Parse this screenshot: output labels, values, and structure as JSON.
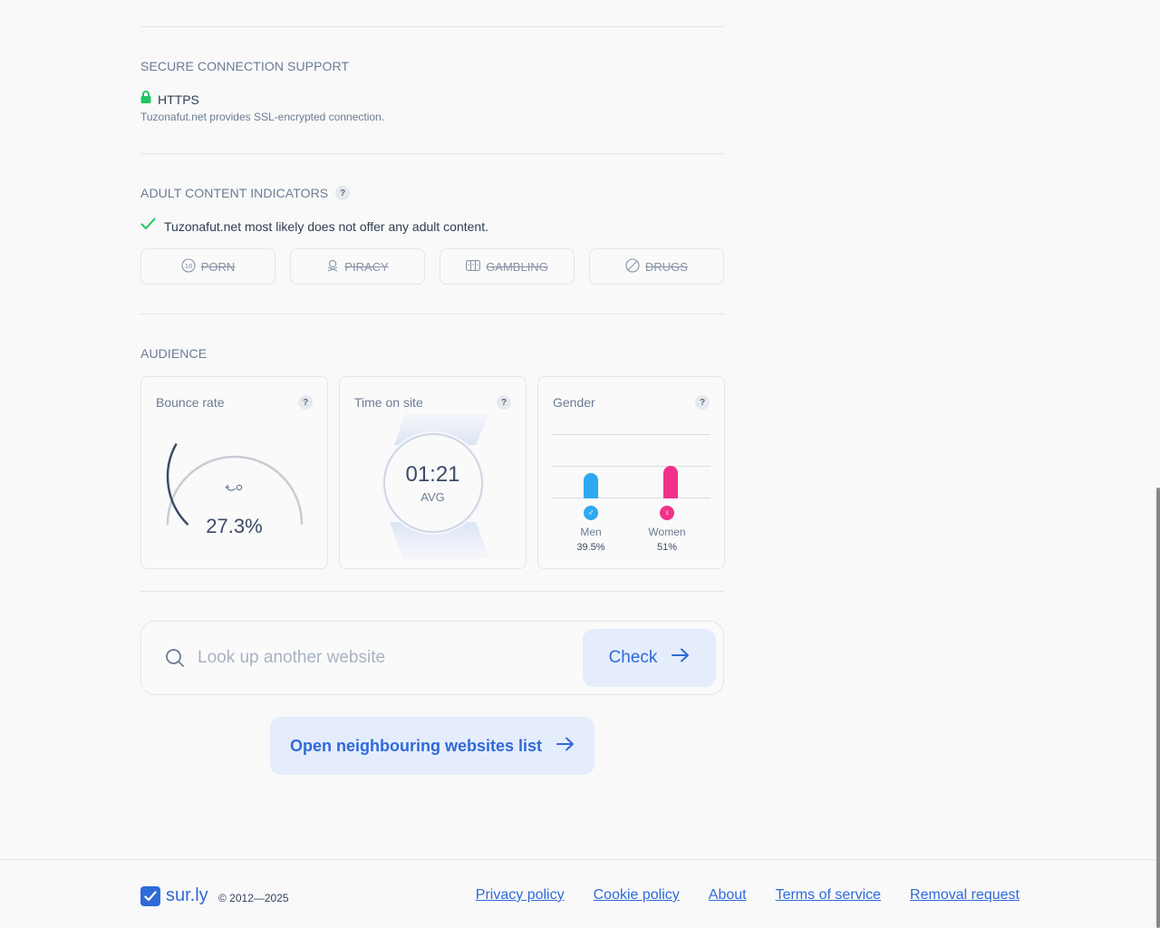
{
  "secure": {
    "title": "SECURE CONNECTION SUPPORT",
    "protocol": "HTTPS",
    "description": "Tuzonafut.net provides SSL-encrypted connection."
  },
  "adult": {
    "title": "ADULT CONTENT INDICATORS",
    "help": "?",
    "verdict": "Tuzonafut.net most likely does not offer any adult content.",
    "indicators": [
      {
        "label": "PORN",
        "icon": "18-icon"
      },
      {
        "label": "PIRACY",
        "icon": "skull-icon"
      },
      {
        "label": "GAMBLING",
        "icon": "slot-machine-icon"
      },
      {
        "label": "DRUGS",
        "icon": "no-drugs-icon"
      }
    ]
  },
  "audience": {
    "title": "AUDIENCE",
    "bounce": {
      "label": "Bounce rate",
      "value": "27.3%",
      "fraction": 0.273,
      "help": "?"
    },
    "time": {
      "label": "Time on site",
      "value": "01:21",
      "sub": "AVG",
      "help": "?"
    },
    "gender": {
      "label": "Gender",
      "help": "?",
      "men": {
        "label": "Men",
        "value": "39.5%",
        "icon": "♂",
        "color": "#2ea8f0"
      },
      "women": {
        "label": "Women",
        "value": "51%",
        "icon": "♀",
        "color": "#f0318a"
      }
    }
  },
  "search": {
    "placeholder": "Look up another website",
    "button": "Check"
  },
  "neighbours": {
    "button": "Open neighbouring websites list"
  },
  "footer": {
    "logo": "sur.ly",
    "copyright": "© 2012—2025",
    "links": [
      "Privacy policy",
      "Cookie policy",
      "About",
      "Terms of service",
      "Removal request"
    ]
  },
  "colors": {
    "accent": "#2f6ad9",
    "ok": "#22c55e",
    "men": "#2ea8f0",
    "women": "#f0318a"
  }
}
